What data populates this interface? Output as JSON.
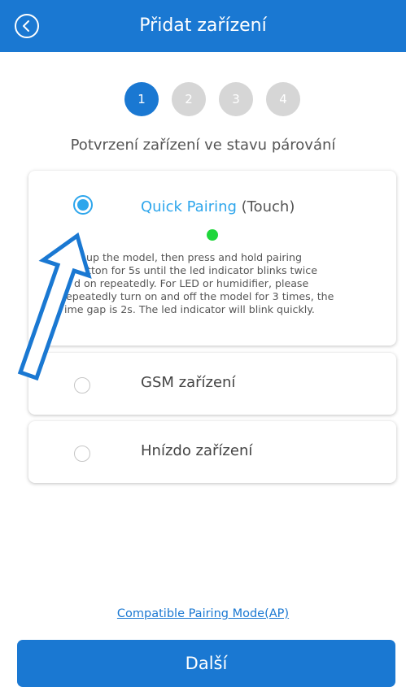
{
  "header": {
    "title": "Přidat zařízení",
    "back_icon": "chevron-left-circle-icon"
  },
  "steps": [
    "1",
    "2",
    "3",
    "4"
  ],
  "active_step": 1,
  "subtitle": "Potvrzení zařízení ve stavu párování",
  "options": {
    "quick": {
      "title_accent": "Quick Pairing",
      "title_rest": " (Touch)",
      "selected": true,
      "led_color": "#1fd63b",
      "description_lines": [
        "up the model, then press and hold pairing",
        "tton for 5s until the led indicator blinks twice",
        "d on repeatedly. For LED or humidifier, please",
        "epeatedly turn on and off the model for 3 times, the",
        "ime gap is 2s. The led indicator will blink quickly."
      ]
    },
    "gsm": {
      "label": "GSM zařízení",
      "selected": false
    },
    "nest": {
      "label": "Hnízdo zařízení",
      "selected": false
    }
  },
  "compat_link": "Compatible Pairing Mode(AP)",
  "next_button": "Další",
  "colors": {
    "primary": "#1a78d2",
    "accent": "#2ea6ec",
    "step_inactive": "#d6d6d6",
    "led": "#1fd63b"
  },
  "annotation": {
    "icon": "up-arrow-pointer-icon"
  }
}
